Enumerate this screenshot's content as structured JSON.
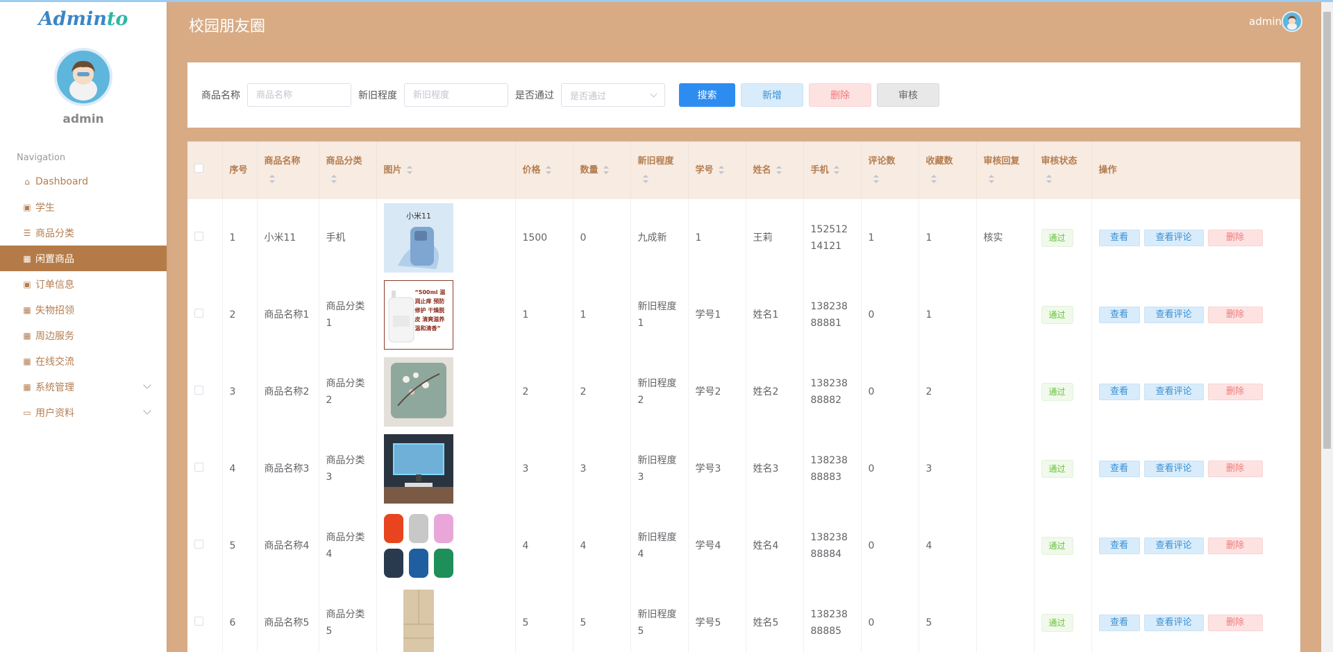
{
  "app": {
    "logo_part1": "Admin",
    "logo_part2": "to",
    "user": "admin"
  },
  "header": {
    "title": "校园朋友圈",
    "user": "admin"
  },
  "sidebar": {
    "nav_title": "Navigation",
    "items": [
      {
        "label": "Dashboard",
        "icon": "home-icon"
      },
      {
        "label": "学生",
        "icon": "clipboard-icon"
      },
      {
        "label": "商品分类",
        "icon": "list-icon"
      },
      {
        "label": "闲置商品",
        "icon": "grid-icon",
        "active": true
      },
      {
        "label": "订单信息",
        "icon": "clipboard-icon"
      },
      {
        "label": "失物招领",
        "icon": "grid-icon"
      },
      {
        "label": "周边服务",
        "icon": "grid-icon"
      },
      {
        "label": "在线交流",
        "icon": "grid-icon"
      },
      {
        "label": "系统管理",
        "icon": "grid-icon",
        "expandable": true
      },
      {
        "label": "用户资料",
        "icon": "calendar-icon",
        "expandable": true
      }
    ]
  },
  "search": {
    "name_label": "商品名称",
    "name_placeholder": "商品名称",
    "condition_label": "新旧程度",
    "condition_placeholder": "新旧程度",
    "pass_label": "是否通过",
    "pass_placeholder": "是否通过",
    "search_button": "搜索",
    "add_button": "新增",
    "delete_button": "删除",
    "audit_button": "审核"
  },
  "table": {
    "columns": [
      "序号",
      "商品名称",
      "商品分类",
      "图片",
      "价格",
      "数量",
      "新旧程度",
      "学号",
      "姓名",
      "手机",
      "评论数",
      "收藏数",
      "审核回复",
      "审核状态",
      "操作"
    ],
    "actions": {
      "view": "查看",
      "comments": "查看评论",
      "delete": "删除"
    },
    "rows": [
      {
        "no": "1",
        "name": "小米11",
        "category": "手机",
        "image_text": "小米11",
        "price": "1500",
        "qty": "0",
        "condition": "九成新",
        "student_no": "1",
        "student_name": "王莉",
        "phone": "15251214121",
        "comments": "1",
        "favorites": "1",
        "reply": "核实",
        "status": "通过"
      },
      {
        "no": "2",
        "name": "商品名称1",
        "category": "商品分类1",
        "image_text": "“500ml 滋润止痒 预防修护 干燥脱皮 清爽滋养 温和清香”",
        "price": "1",
        "qty": "1",
        "condition": "新旧程度1",
        "student_no": "学号1",
        "student_name": "姓名1",
        "phone": "13823888881",
        "comments": "0",
        "favorites": "1",
        "reply": "",
        "status": "通过"
      },
      {
        "no": "3",
        "name": "商品名称2",
        "category": "商品分类2",
        "image_text": "",
        "price": "2",
        "qty": "2",
        "condition": "新旧程度2",
        "student_no": "学号2",
        "student_name": "姓名2",
        "phone": "13823888882",
        "comments": "0",
        "favorites": "2",
        "reply": "",
        "status": "通过"
      },
      {
        "no": "4",
        "name": "商品名称3",
        "category": "商品分类3",
        "image_text": "",
        "price": "3",
        "qty": "3",
        "condition": "新旧程度3",
        "student_no": "学号3",
        "student_name": "姓名3",
        "phone": "13823888883",
        "comments": "0",
        "favorites": "3",
        "reply": "",
        "status": "通过"
      },
      {
        "no": "5",
        "name": "商品名称4",
        "category": "商品分类4",
        "image_text": "",
        "price": "4",
        "qty": "4",
        "condition": "新旧程度4",
        "student_no": "学号4",
        "student_name": "姓名4",
        "phone": "13823888884",
        "comments": "0",
        "favorites": "4",
        "reply": "",
        "status": "通过"
      },
      {
        "no": "6",
        "name": "商品名称5",
        "category": "商品分类5",
        "image_text": "",
        "price": "5",
        "qty": "5",
        "condition": "新旧程度5",
        "student_no": "学号5",
        "student_name": "姓名5",
        "phone": "13823888885",
        "comments": "0",
        "favorites": "5",
        "reply": "",
        "status": "通过"
      }
    ]
  },
  "colors": {
    "sidebar_active": "#b47b48",
    "page_bg": "#d8ab84",
    "primary": "#2d8cf0"
  }
}
